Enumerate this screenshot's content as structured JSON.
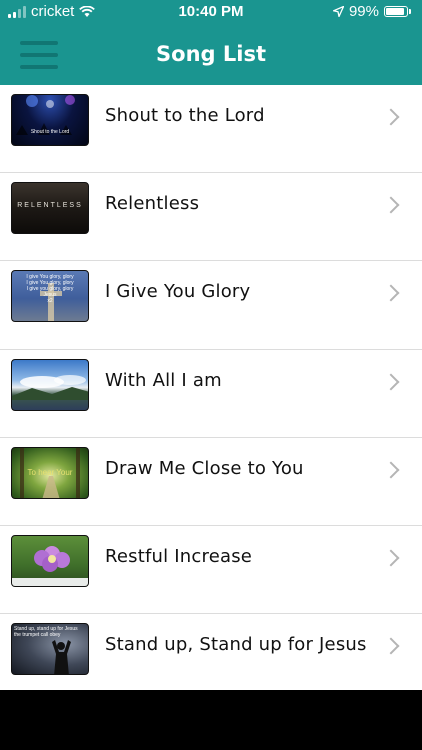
{
  "status": {
    "carrier": "cricket",
    "time": "10:40 PM",
    "battery": "99%",
    "battery_level": 0.99
  },
  "header": {
    "title": "Song List"
  },
  "songs": [
    {
      "title": "Shout to the Lord",
      "thumb_text": "Shout to the Lord"
    },
    {
      "title": "Relentless",
      "thumb_text": "RELENTLESS"
    },
    {
      "title": "I Give You Glory",
      "thumb_text": "I give You glory, glory\nI give You glory, glory\nI give you glory, glory\nJesus\nx2"
    },
    {
      "title": "With All I am",
      "thumb_text": ""
    },
    {
      "title": "Draw Me Close to You",
      "thumb_text": "To hear Your"
    },
    {
      "title": "Restful Increase",
      "thumb_text": ""
    },
    {
      "title": "Stand up, Stand up for Jesus",
      "thumb_text": "Stand up, stand up for Jesus\nthe trumpet call obey"
    }
  ],
  "colors": {
    "accent": "#1a9590",
    "menu_icon": "#117673",
    "chevron": "#b5b5b5",
    "divider": "#dcdcdc"
  },
  "icons": {
    "menu": "hamburger-icon",
    "disclosure": "chevron-right-icon",
    "location": "location-arrow-icon",
    "wifi": "wifi-icon",
    "signal": "signal-bars-icon",
    "battery": "battery-icon"
  }
}
